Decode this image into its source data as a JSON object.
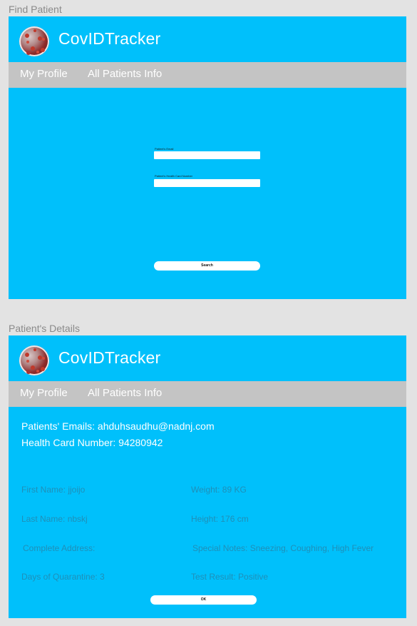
{
  "frames": {
    "find_label": "Find Patient",
    "details_label": "Patient's Details"
  },
  "app": {
    "title": "CovIDTracker",
    "logo_icon": "virus-logo-icon"
  },
  "nav": {
    "profile": "My Profile",
    "patients": "All Patients Info"
  },
  "find": {
    "email_label": "Patient's Email",
    "email_value": "",
    "health_label": "Patient's Health Card Number",
    "health_value": "",
    "search_label": "Search"
  },
  "details": {
    "emails": "Patients' Emails:  ahduhsaudhu@nadnj.com",
    "health_card": "Health Card Number: 94280942",
    "first_name": "First Name: jjoijo",
    "last_name": "Last Name: nbskj",
    "address": "Complete Address:",
    "quarantine": "Days of Quarantine: 3",
    "weight": "Weight: 89 KG",
    "height": "Height: 176 cm",
    "notes": "Special Notes: Sneezing, Coughing, High Fever",
    "test_result": "Test Result: Positive",
    "ok_label": "OK"
  },
  "colors": {
    "primary": "#00c0fb",
    "nav_bg": "#c4c4c4",
    "page_bg": "#e3e3e3",
    "muted_text": "#1f8fb8"
  }
}
